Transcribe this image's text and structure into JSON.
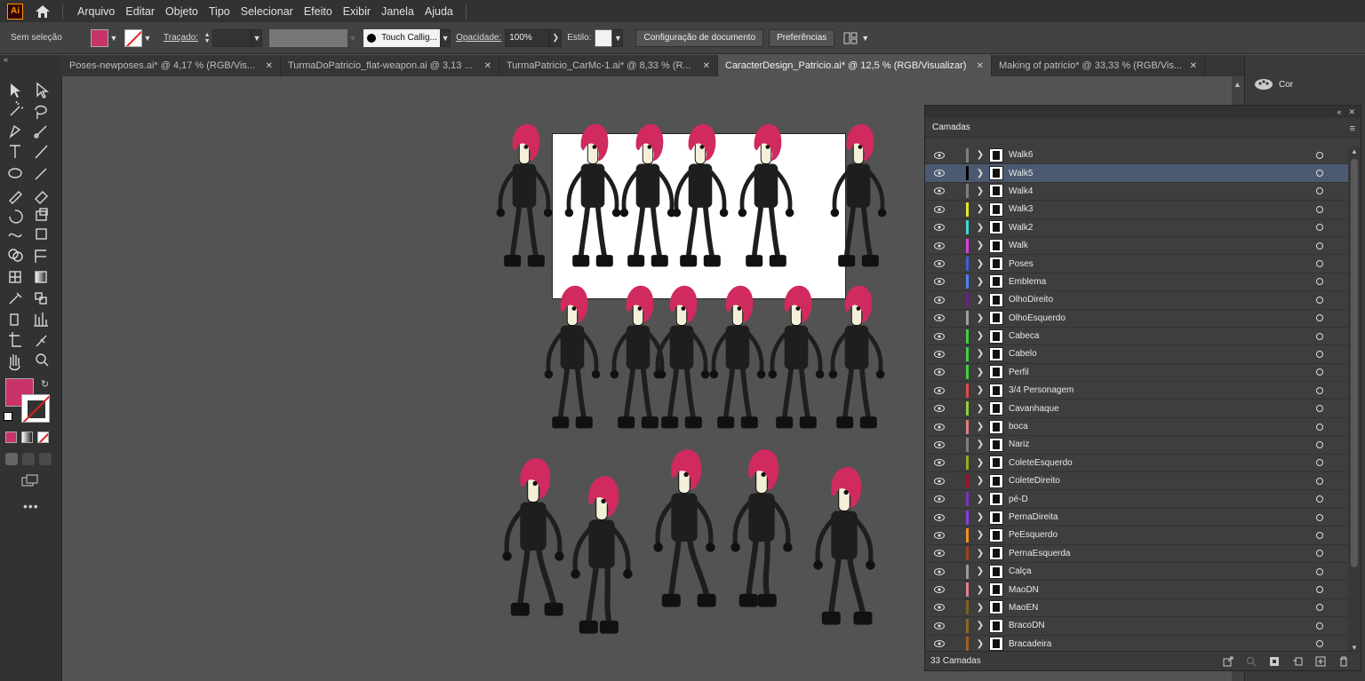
{
  "app": {
    "logo": "Ai",
    "menus": [
      "Arquivo",
      "Editar",
      "Objeto",
      "Tipo",
      "Selecionar",
      "Efeito",
      "Exibir",
      "Janela",
      "Ajuda"
    ]
  },
  "controlbar": {
    "selection_label": "Sem seleção",
    "fill_color": "#c8336a",
    "stroke_label": "Traçado:",
    "brush_label": "Touch Callig...",
    "opacity_label": "Opacidade:",
    "opacity_value": "100%",
    "style_label": "Estilo:",
    "doc_setup_button": "Configuração de documento",
    "preferences_button": "Preferências"
  },
  "tabs": [
    {
      "label": "Poses-newposes.ai* @ 4,17 % (RGB/Vis...",
      "active": false
    },
    {
      "label": "TurmaDoPatricio_flat-weapon.ai @ 3,13 ...",
      "active": false
    },
    {
      "label": "TurmaPatricio_CarMc-1.ai* @ 8,33 % (R...",
      "active": false
    },
    {
      "label": "CaracterDesign_Patricio.ai* @ 12,5 % (RGB/Visualizar)",
      "active": true
    },
    {
      "label": "Making of patricio* @ 33,33 % (RGB/Vis...",
      "active": false
    }
  ],
  "right_dock": {
    "color_panel_label": "Cor"
  },
  "layers_panel": {
    "title": "Camadas",
    "count_label": "33 Camadas",
    "layers": [
      {
        "name": "Walk6",
        "color": "#7f7f7f",
        "selected": false
      },
      {
        "name": "Walk5",
        "color": "#000000",
        "selected": true
      },
      {
        "name": "Walk4",
        "color": "#7f7f7f",
        "selected": false
      },
      {
        "name": "Walk3",
        "color": "#e6e62e",
        "selected": false
      },
      {
        "name": "Walk2",
        "color": "#3ed8d8",
        "selected": false
      },
      {
        "name": "Walk",
        "color": "#e040e0",
        "selected": false
      },
      {
        "name": "Poses",
        "color": "#3f5fd8",
        "selected": false
      },
      {
        "name": "Emblema",
        "color": "#4f7ff0",
        "selected": false
      },
      {
        "name": "OlhoDireito",
        "color": "#6a1f8a",
        "selected": false
      },
      {
        "name": "OlhoEsquerdo",
        "color": "#a0a0a0",
        "selected": false
      },
      {
        "name": "Cabeca",
        "color": "#43d043",
        "selected": false
      },
      {
        "name": "Cabelo",
        "color": "#43d043",
        "selected": false
      },
      {
        "name": "Perfil",
        "color": "#43d043",
        "selected": false
      },
      {
        "name": "3/4 Personagem",
        "color": "#e04a4a",
        "selected": false
      },
      {
        "name": "Cavanhaque",
        "color": "#8fd03a",
        "selected": false
      },
      {
        "name": "boca",
        "color": "#e08080",
        "selected": false
      },
      {
        "name": "Nariz",
        "color": "#7f7f7f",
        "selected": false
      },
      {
        "name": "ColeteEsquerdo",
        "color": "#8fb020",
        "selected": false
      },
      {
        "name": "ColeteDireito",
        "color": "#a01030",
        "selected": false
      },
      {
        "name": "pé-D",
        "color": "#8030c0",
        "selected": false
      },
      {
        "name": "PernaDireita",
        "color": "#8040e0",
        "selected": false
      },
      {
        "name": "PeEsquerdo",
        "color": "#f09020",
        "selected": false
      },
      {
        "name": "PernaEsquerda",
        "color": "#a04020",
        "selected": false
      },
      {
        "name": "Calça",
        "color": "#9a9a9a",
        "selected": false
      },
      {
        "name": "MaoDN",
        "color": "#e08090",
        "selected": false
      },
      {
        "name": "MaoEN",
        "color": "#806020",
        "selected": false
      },
      {
        "name": "BracoDN",
        "color": "#8a6a20",
        "selected": false
      },
      {
        "name": "Bracadeira",
        "color": "#a06020",
        "selected": false
      }
    ]
  },
  "colors": {
    "hair": "#d02a5e",
    "body": "#1e1e1e",
    "skin": "#f4f0d8"
  }
}
